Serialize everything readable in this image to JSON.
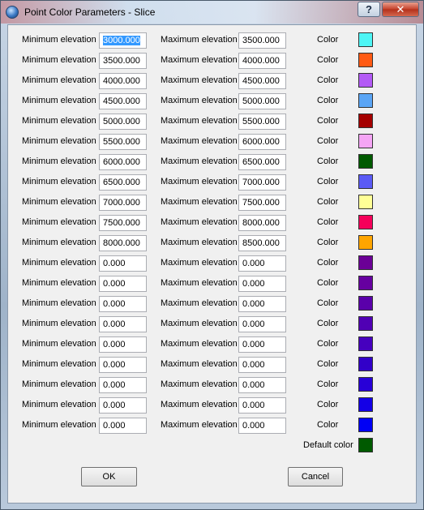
{
  "window": {
    "title": "Point Color Parameters - Slice",
    "help_label": "?",
    "close_label": "✕"
  },
  "labels": {
    "min": "Minimum elevation",
    "max": "Maximum elevation",
    "color": "Color",
    "default_color": "Default color"
  },
  "rows": [
    {
      "min": "3000.000",
      "max": "3500.000",
      "color": "#4ef5f5"
    },
    {
      "min": "3500.000",
      "max": "4000.000",
      "color": "#ff5a14"
    },
    {
      "min": "4000.000",
      "max": "4500.000",
      "color": "#b35af5"
    },
    {
      "min": "4500.000",
      "max": "5000.000",
      "color": "#5aa5f5"
    },
    {
      "min": "5000.000",
      "max": "5500.000",
      "color": "#a50000"
    },
    {
      "min": "5500.000",
      "max": "6000.000",
      "color": "#f5a5f5"
    },
    {
      "min": "6000.000",
      "max": "6500.000",
      "color": "#005a00"
    },
    {
      "min": "6500.000",
      "max": "7000.000",
      "color": "#5a5af5"
    },
    {
      "min": "7000.000",
      "max": "7500.000",
      "color": "#ffff96"
    },
    {
      "min": "7500.000",
      "max": "8000.000",
      "color": "#f5005a"
    },
    {
      "min": "8000.000",
      "max": "8500.000",
      "color": "#ffa500"
    },
    {
      "min": "0.000",
      "max": "0.000",
      "color": "#6b0096"
    },
    {
      "min": "0.000",
      "max": "0.000",
      "color": "#6600a0"
    },
    {
      "min": "0.000",
      "max": "0.000",
      "color": "#5a00aa"
    },
    {
      "min": "0.000",
      "max": "0.000",
      "color": "#5000b4"
    },
    {
      "min": "0.000",
      "max": "0.000",
      "color": "#4600be"
    },
    {
      "min": "0.000",
      "max": "0.000",
      "color": "#3200c8"
    },
    {
      "min": "0.000",
      "max": "0.000",
      "color": "#2800d7"
    },
    {
      "min": "0.000",
      "max": "0.000",
      "color": "#1400e6"
    },
    {
      "min": "0.000",
      "max": "0.000",
      "color": "#0000f5"
    }
  ],
  "default_color": "#005a00",
  "buttons": {
    "ok": "OK",
    "cancel": "Cancel"
  }
}
